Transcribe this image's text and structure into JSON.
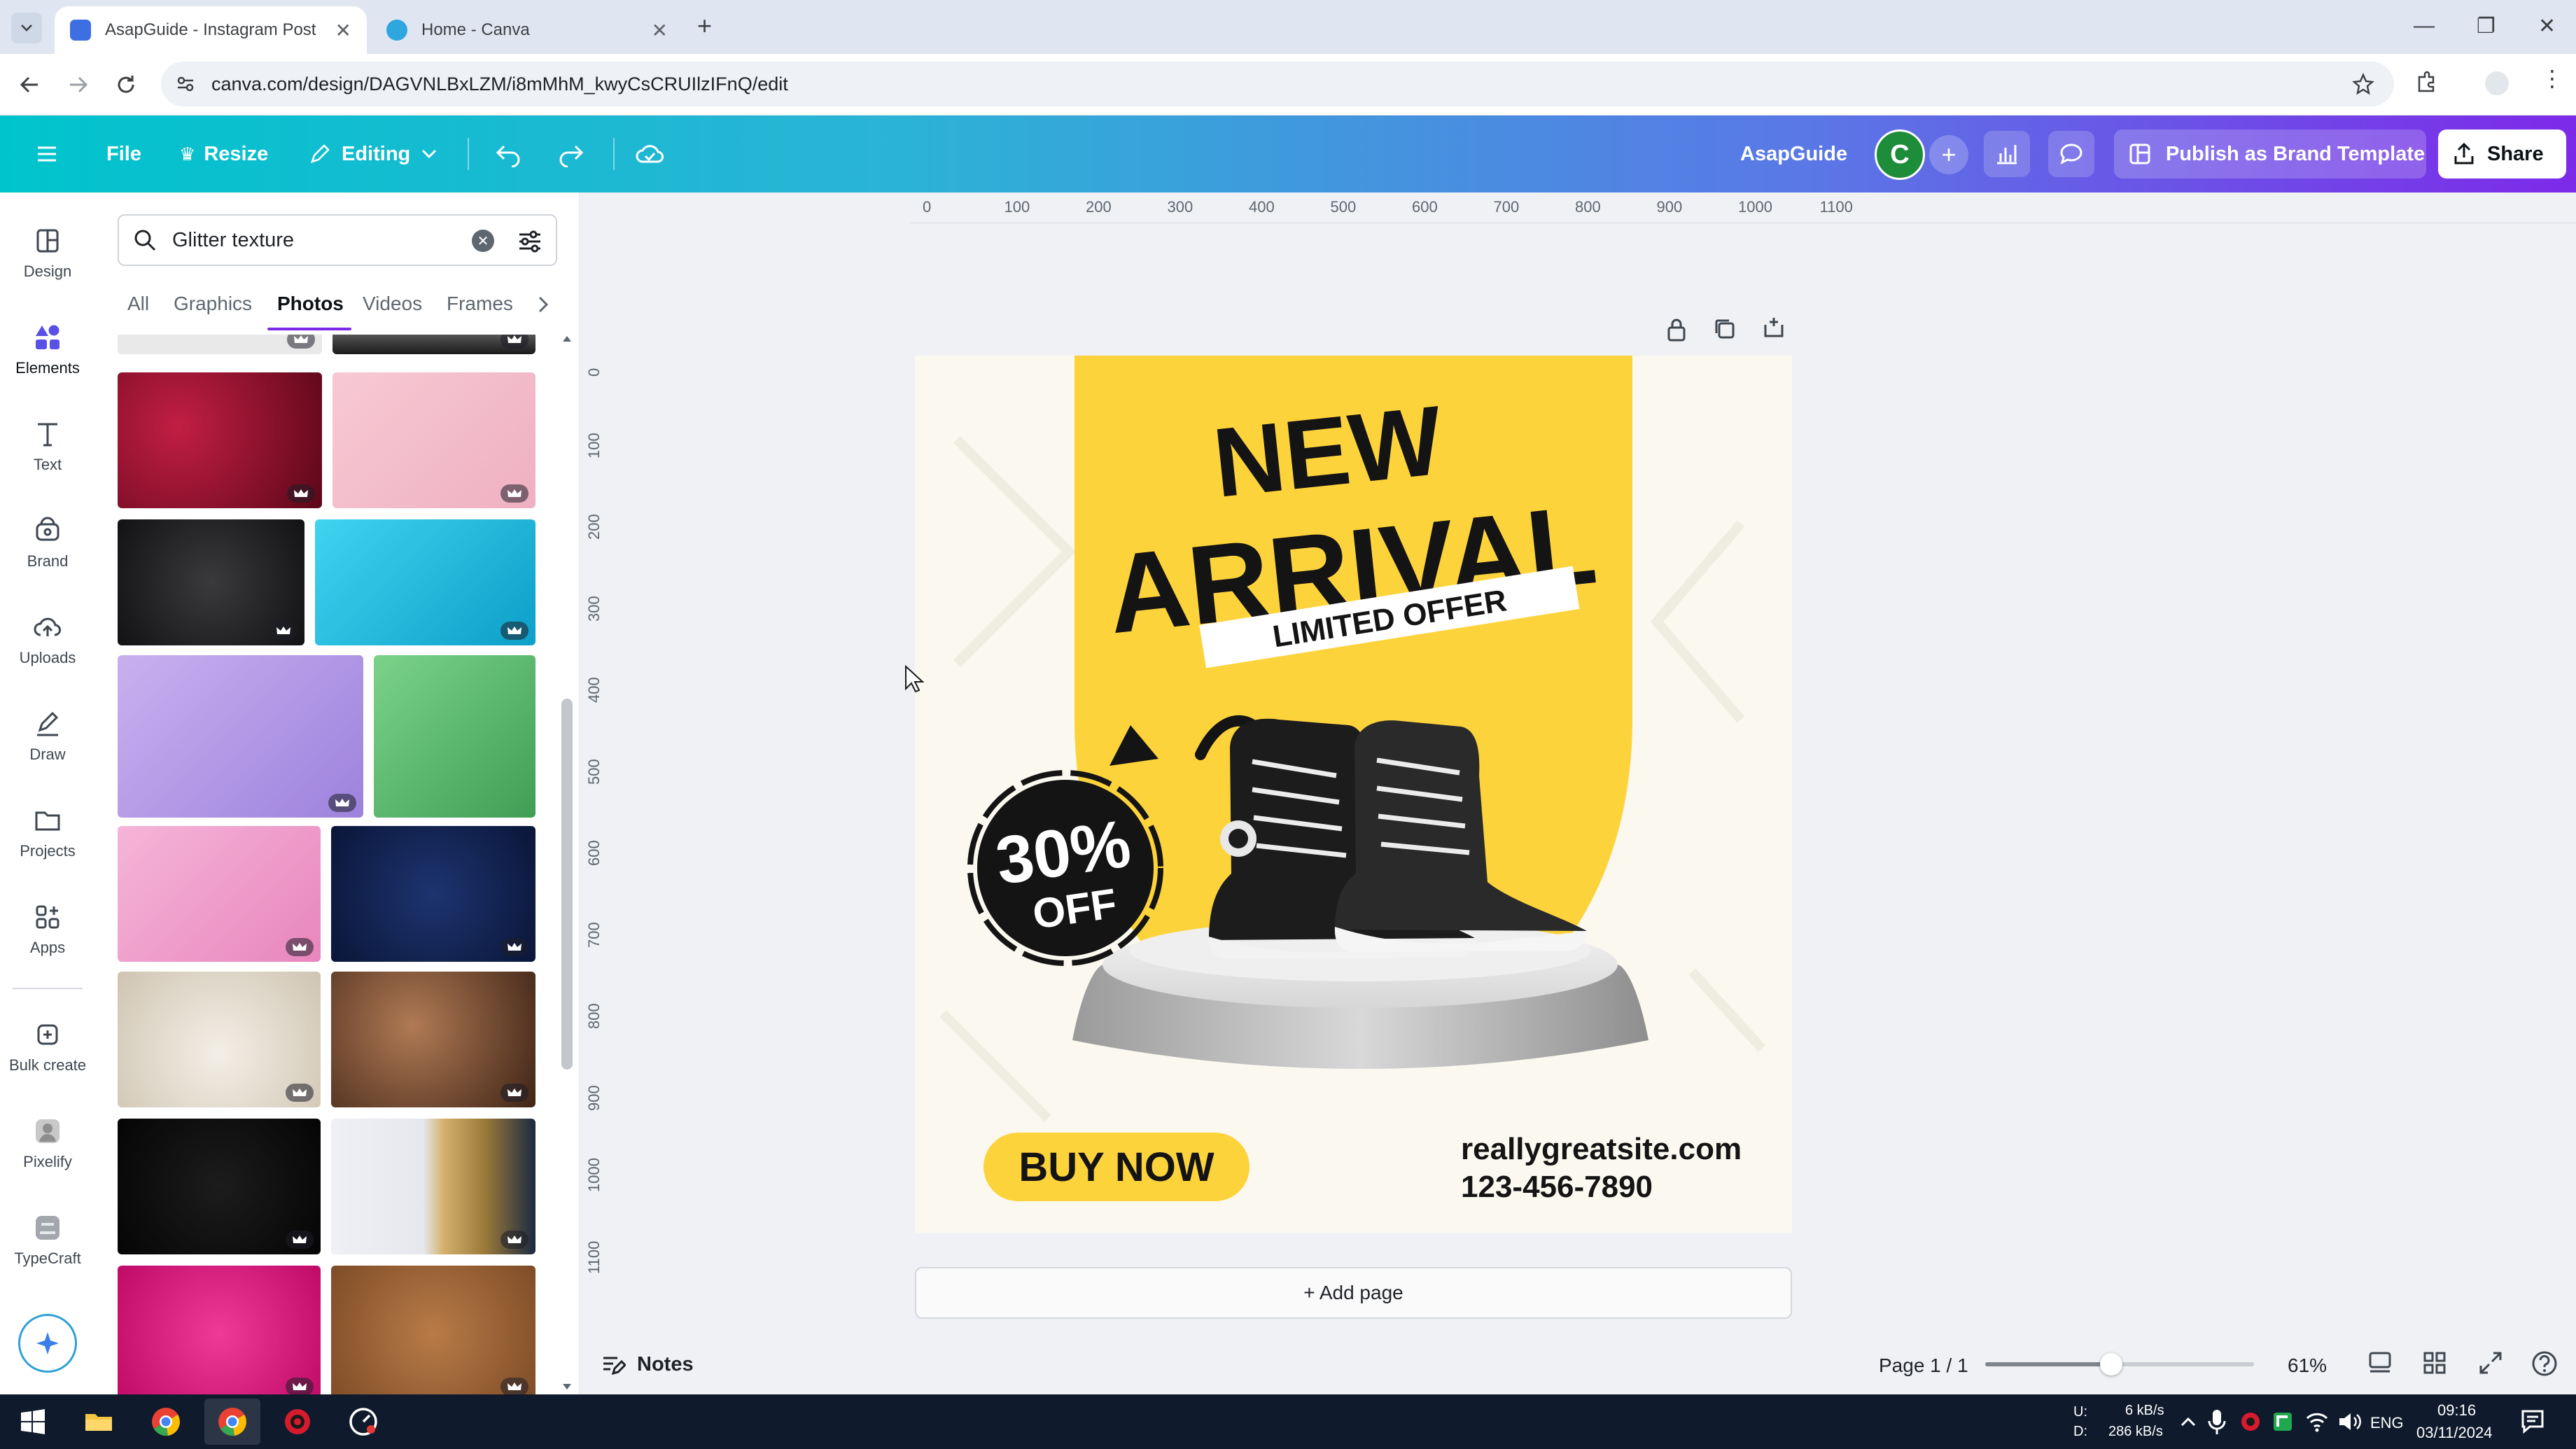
{
  "browser": {
    "tabs": [
      {
        "label": "AsapGuide - Instagram Post",
        "active": true
      },
      {
        "label": "Home - Canva",
        "active": false
      }
    ],
    "url": "canva.com/design/DAGVNLBxLZM/i8mMhM_kwyCsCRUIlzIFnQ/edit"
  },
  "toolbar": {
    "file_label": "File",
    "resize_label": "Resize",
    "editing_label": "Editing",
    "team_name": "AsapGuide",
    "avatar_initial": "C",
    "publish_label": "Publish as Brand Template",
    "share_label": "Share"
  },
  "rail": {
    "items": [
      {
        "label": "Design",
        "icon": "layout-icon"
      },
      {
        "label": "Elements",
        "icon": "elements-icon"
      },
      {
        "label": "Text",
        "icon": "text-icon"
      },
      {
        "label": "Brand",
        "icon": "brand-icon"
      },
      {
        "label": "Uploads",
        "icon": "cloud-upload-icon"
      },
      {
        "label": "Draw",
        "icon": "pen-icon"
      },
      {
        "label": "Projects",
        "icon": "folder-icon"
      },
      {
        "label": "Apps",
        "icon": "apps-icon"
      },
      {
        "label": "Bulk create",
        "icon": "bulk-create-icon"
      },
      {
        "label": "Pixelify",
        "icon": "pixelify-icon"
      },
      {
        "label": "TypeCraft",
        "icon": "typecraft-icon"
      }
    ]
  },
  "panel": {
    "search_value": "Glitter texture",
    "categories": [
      "All",
      "Graphics",
      "Photos",
      "Videos",
      "Frames"
    ],
    "active_category": "Photos",
    "thumb_colors": {
      "partial_white": "#e9e9ea",
      "partial_dark": "#2a2a2c",
      "red": "#8a0d2a",
      "pink_light": "#f3bccb",
      "black": "#232325",
      "cyan": "#12b5da",
      "lavender": "#b79ae6",
      "green": "#5bbd6e",
      "pink": "#ef9dc9",
      "navy": "#0f2250",
      "champagne": "#e5ddd0",
      "bronze": "#7a4b33",
      "black_sparkle": "#0c0c0c",
      "gold_foil": "#c9a460",
      "magenta": "#e0157f",
      "copper": "#a0673a"
    }
  },
  "ruler": {
    "x": [
      "0",
      "100",
      "200",
      "300",
      "400",
      "500",
      "600",
      "700",
      "800",
      "900",
      "1000",
      "1100"
    ],
    "y": [
      "0",
      "100",
      "200",
      "300",
      "400",
      "500",
      "600",
      "700",
      "800",
      "900",
      "1000",
      "1100"
    ]
  },
  "design": {
    "headline_1": "NEW",
    "headline_2": "ARRIVAL",
    "ribbon": "LIMITED OFFER",
    "badge_top": "30%",
    "badge_bottom": "OFF",
    "cta": "BUY NOW",
    "website": "reallygreatsite.com",
    "phone": "123-456-7890",
    "colors": {
      "yellow": "#fdd33c",
      "background": "#fbf9ef",
      "text": "#141414"
    }
  },
  "canvas": {
    "add_page_label": "+ Add page",
    "notes_label": "Notes",
    "page_indicator": "Page 1 / 1",
    "zoom": "61%",
    "zoom_level": 0.47
  },
  "taskbar": {
    "net_up": "6 kB/s",
    "net_down": "286 kB/s",
    "net_up_label": "U:",
    "net_down_label": "D:",
    "lang": "ENG",
    "time": "09:16",
    "date": "03/11/2024"
  }
}
